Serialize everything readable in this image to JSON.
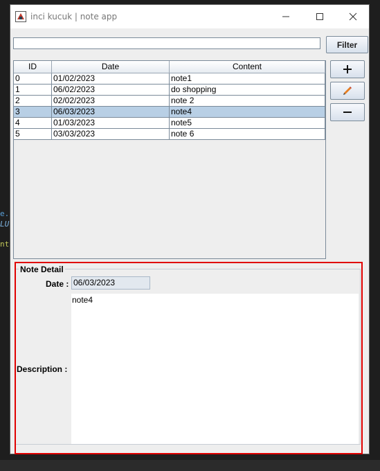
{
  "window": {
    "title": "inci kucuk | note app"
  },
  "background_code": {
    "line1": "e.",
    "line2": "LU",
    "line3": "nt"
  },
  "toolbar": {
    "filter_placeholder": "",
    "filter_label": "Filter"
  },
  "side_buttons": {
    "add_icon": "plus-icon",
    "edit_icon": "pencil-icon",
    "remove_icon": "minus-icon"
  },
  "table": {
    "headers": [
      "ID",
      "Date",
      "Content"
    ],
    "rows": [
      {
        "id": "0",
        "date": "01/02/2023",
        "content": "note1"
      },
      {
        "id": "1",
        "date": "06/02/2023",
        "content": "do shopping"
      },
      {
        "id": "2",
        "date": "02/02/2023",
        "content": "note 2"
      },
      {
        "id": "3",
        "date": "06/03/2023",
        "content": "note4"
      },
      {
        "id": "4",
        "date": "01/03/2023",
        "content": "note5"
      },
      {
        "id": "5",
        "date": "03/03/2023",
        "content": "note 6"
      }
    ],
    "selected_row": 3
  },
  "detail": {
    "legend": "Note Detail",
    "date_label": "Date :",
    "date_value": "06/03/2023",
    "description_label": "Description :",
    "description_value": "note4"
  },
  "colors": {
    "selection": "#b8cfe5",
    "highlight_border": "#e00000"
  }
}
